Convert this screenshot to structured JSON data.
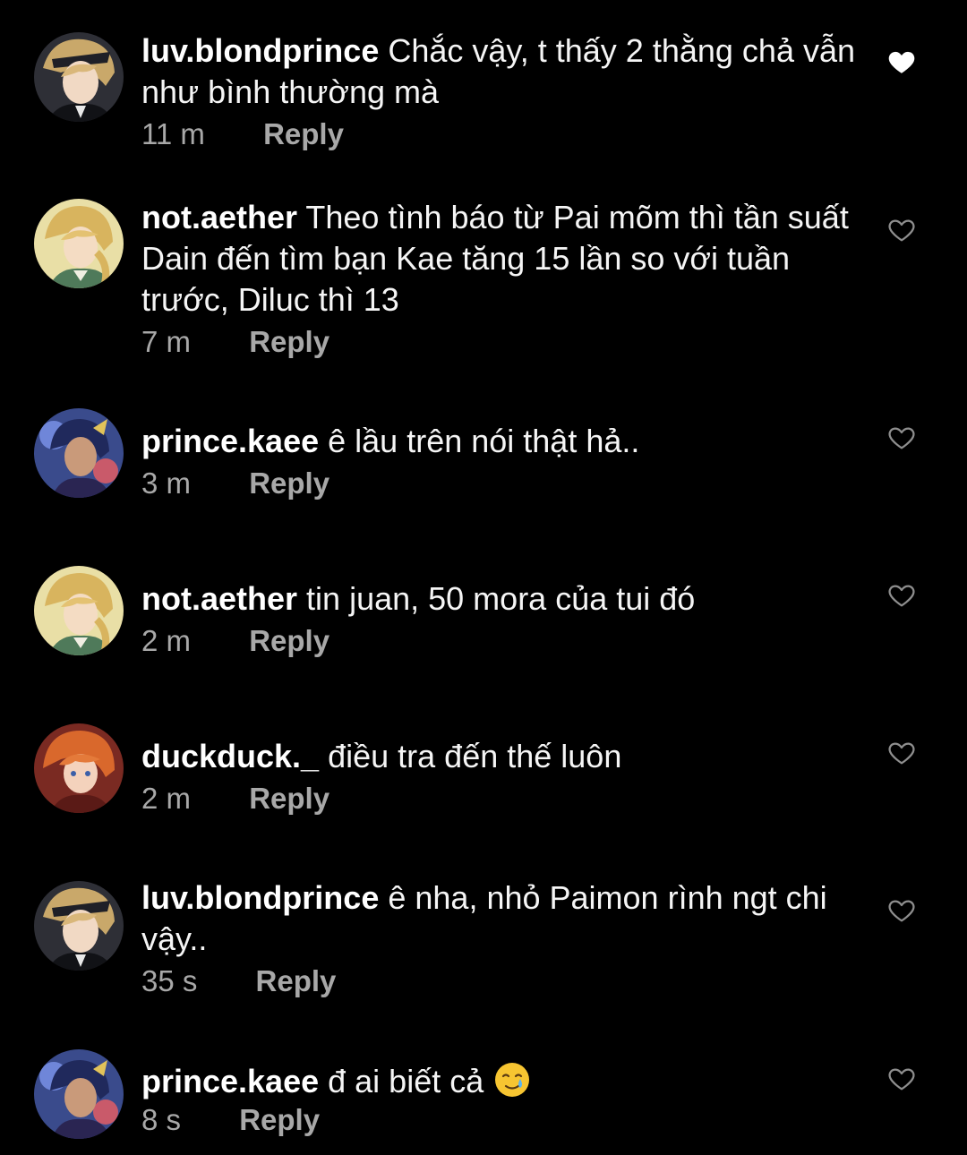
{
  "colors": {
    "background": "#000000",
    "text": "#f5f5f5",
    "meta": "#a8a8a8",
    "liked_heart": "#ffffff",
    "unliked_heart": "#8e8e8e"
  },
  "reply_label": "Reply",
  "comments": [
    {
      "username": "luv.blondprince",
      "text": "Chắc vậy, t thấy 2 thằng chả vẫn như bình thường mà",
      "time": "11 m",
      "liked": true,
      "avatar_icon": "blond-prince-avatar"
    },
    {
      "username": "not.aether",
      "text": "Theo tình báo từ Pai mõm thì tần suất Dain đến tìm bạn Kae tăng 15 lần so với tuần trước, Diluc thì 13",
      "time": "7 m",
      "liked": false,
      "avatar_icon": "aether-avatar"
    },
    {
      "username": "prince.kaee",
      "text": "ê lầu trên nói thật hả..",
      "time": "3 m",
      "liked": false,
      "avatar_icon": "kaeya-avatar"
    },
    {
      "username": "not.aether",
      "text": "tin juan, 50 mora của tui đó",
      "time": "2 m",
      "liked": false,
      "avatar_icon": "aether-avatar"
    },
    {
      "username": "duckduck._",
      "text": "điều tra đến thế luôn",
      "time": "2 m",
      "liked": false,
      "avatar_icon": "childe-avatar"
    },
    {
      "username": "luv.blondprince",
      "text": "ê nha, nhỏ Paimon rình ngt chi vậy..",
      "time": "35 s",
      "liked": false,
      "avatar_icon": "blond-prince-avatar"
    },
    {
      "username": "prince.kaee",
      "text": "đ ai biết cả",
      "time": "8 s",
      "liked": false,
      "avatar_icon": "kaeya-avatar",
      "emoji_icon": "smiling-face-with-tear-emoji"
    }
  ]
}
